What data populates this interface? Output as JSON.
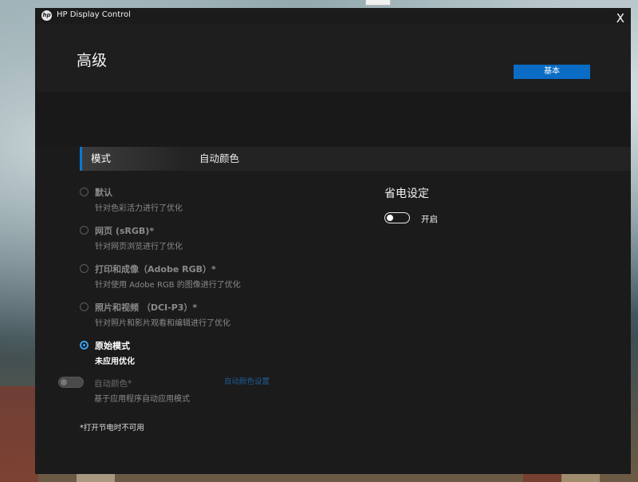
{
  "app": {
    "title": "HP Display Control",
    "logo": "hp",
    "close": "X"
  },
  "header": {
    "title": "高级",
    "basic_button": "基本"
  },
  "tabs": [
    {
      "label": "模式",
      "selected": true
    },
    {
      "label": "自动颜色",
      "selected": false
    }
  ],
  "modes": [
    {
      "label": "默认",
      "desc": "针对色彩活力进行了优化",
      "selected": false
    },
    {
      "label": "网页 (sRGB)*",
      "desc": "针对网页浏览进行了优化",
      "selected": false
    },
    {
      "label": "打印和成像（Adobe RGB）*",
      "desc": "针对使用 Adobe RGB 的图像进行了优化",
      "selected": false
    },
    {
      "label": "照片和视频 （DCI-P3）*",
      "desc": "针对照片和影片观看和编辑进行了优化",
      "selected": false
    },
    {
      "label": "原始模式",
      "desc": "未应用优化",
      "selected": true
    }
  ],
  "auto_color": {
    "label": "自动颜色*",
    "desc": "基于应用程序自动应用模式",
    "settings_link": "自动颜色设置",
    "enabled": false
  },
  "footnote": "*打开节电时不可用",
  "power": {
    "title": "省电设定",
    "state_label": "开启",
    "on": false
  },
  "colors": {
    "accent": "#0a6cc4",
    "radio_selected": "#3aa0f0",
    "background": "#1b1b1b"
  }
}
